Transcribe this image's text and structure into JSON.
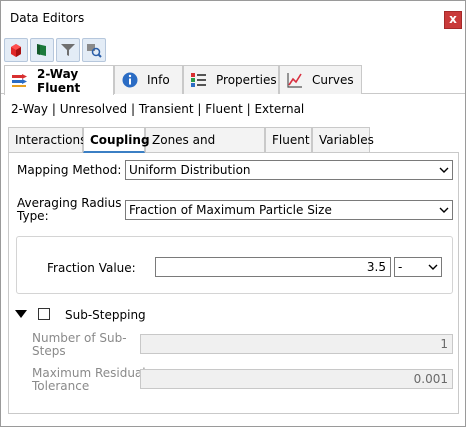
{
  "window": {
    "title": "Data Editors",
    "close_glyph": "x"
  },
  "toolbar": {
    "buttons": [
      {
        "icon": "red-cube-icon"
      },
      {
        "icon": "green-flag-icon"
      },
      {
        "icon": "filter-icon"
      },
      {
        "icon": "search-object-icon"
      }
    ]
  },
  "main_tabs": [
    {
      "label": "2-Way Fluent",
      "icon": "two-way-coupling-icon",
      "active": true
    },
    {
      "label": "Info",
      "icon": "info-icon",
      "active": false
    },
    {
      "label": "Properties",
      "icon": "properties-icon",
      "active": false
    },
    {
      "label": "Curves",
      "icon": "curves-icon",
      "active": false
    }
  ],
  "subtitle": "2-Way | Unresolved | Transient | Fluent | External",
  "sub_tabs": [
    {
      "label": "Interactions",
      "active": false
    },
    {
      "label": "Coupling",
      "active": true
    },
    {
      "label": "Zones and Interfaces",
      "active": false
    },
    {
      "label": "Fluent",
      "active": false
    },
    {
      "label": "Variables",
      "active": false
    }
  ],
  "form": {
    "mapping_method": {
      "label": "Mapping Method:",
      "value": "Uniform Distribution"
    },
    "averaging_radius_type": {
      "label_line1": "Averaging Radius",
      "label_line2": "Type:",
      "value": "Fraction of Maximum Particle Size"
    },
    "fraction_value": {
      "label": "Fraction Value:",
      "value": "3.5",
      "unit": "-"
    },
    "sub_stepping": {
      "label": "Sub-Stepping",
      "checked": false,
      "number_of_substeps": {
        "label_line1": "Number of Sub-",
        "label_line2": "Steps",
        "value": "1"
      },
      "max_residual_tolerance": {
        "label_line1": "Maximum Residual",
        "label_line2": "Tolerance",
        "value": "0.001"
      }
    }
  },
  "colors": {
    "accent": "#3b7fc4",
    "close": "#c93a3a",
    "disabled_text": "#8a8a8a"
  }
}
